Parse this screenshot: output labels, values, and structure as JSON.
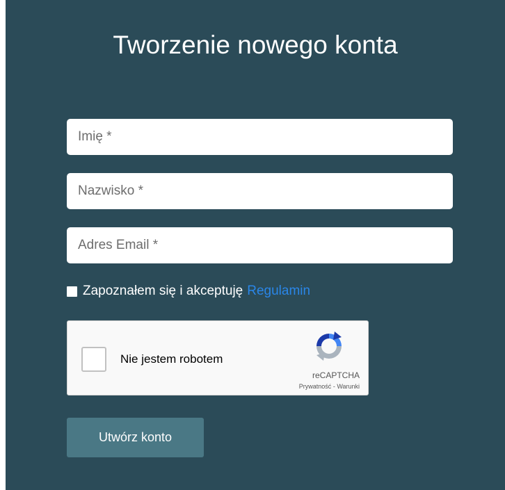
{
  "form": {
    "title": "Tworzenie nowego konta",
    "first_name": {
      "placeholder": "Imię *",
      "value": ""
    },
    "last_name": {
      "placeholder": "Nazwisko *",
      "value": ""
    },
    "email": {
      "placeholder": "Adres Email *",
      "value": ""
    },
    "terms": {
      "text": "Zapoznałem się i akceptuję",
      "link": "Regulamin",
      "checked": false
    },
    "submit_label": "Utwórz konto"
  },
  "captcha": {
    "label": "Nie jestem robotem",
    "brand": "reCAPTCHA",
    "privacy": "Prywatność",
    "separator": " - ",
    "terms": "Warunki",
    "checked": false
  },
  "colors": {
    "panel_bg": "#2b4b58",
    "button_bg": "#4a7885",
    "link": "#2a86e8"
  }
}
